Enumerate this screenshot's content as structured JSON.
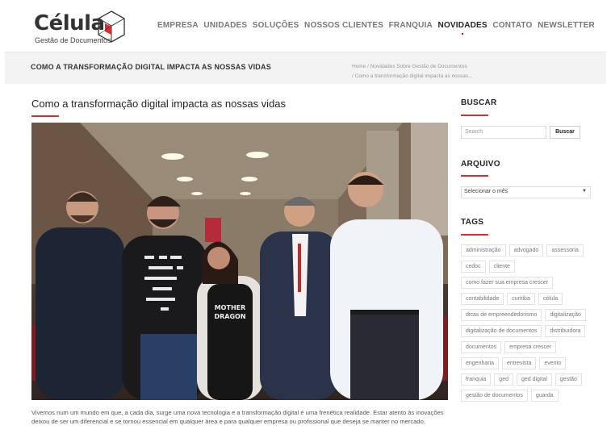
{
  "brand": {
    "name": "Célula",
    "tagline": "Gestão de Documentos"
  },
  "nav": [
    "EMPRESA",
    "UNIDADES",
    "SOLUÇÕES",
    "NOSSOS CLIENTES",
    "FRANQUIA",
    "NOVIDADES",
    "CONTATO",
    "NEWSLETTER"
  ],
  "title_bar": {
    "heading": "COMO A TRANSFORMAÇÃO DIGITAL IMPACTA AS NOSSAS VIDAS",
    "breadcrumb": [
      "Home",
      "Novidades Sobre Gestão de Documentos",
      "Como a transformação digital impacta as nossas..."
    ]
  },
  "post": {
    "title": "Como a transformação digital impacta as nossas vidas",
    "shirt_text": [
      "MOTHER",
      "DRAGON"
    ],
    "excerpt": "Vivemos num um mundo em que, a cada dia, surge uma nova tecnologia e a transformação digital é uma frenética realidade. Estar atento às inovações deixou de ser um diferencial e se tornou essencial em qualquer área e para qualquer empresa ou profissional que deseja se manter no mercado."
  },
  "sidebar": {
    "search": {
      "heading": "BUSCAR",
      "placeholder": "Search",
      "button": "Buscar"
    },
    "archive": {
      "heading": "ARQUIVO",
      "selected": "Selecionar o mês",
      "arrow": "▼"
    },
    "tags": {
      "heading": "TAGS",
      "items": [
        "administração",
        "advogado",
        "assessoria",
        "cedoc",
        "cliente",
        "como fazer sua empresa crescer",
        "contabilidade",
        "curitiba",
        "célula",
        "dicas de empreendedorismo",
        "digitalização",
        "digitalização de documentos",
        "distribuidora",
        "documentos",
        "empresa crescer",
        "engenharia",
        "entrevista",
        "evento",
        "franquia",
        "ged",
        "ged digital",
        "gestão",
        "gestão de documentos",
        "guarda"
      ]
    }
  },
  "colors": {
    "accent": "#d32f2f"
  }
}
